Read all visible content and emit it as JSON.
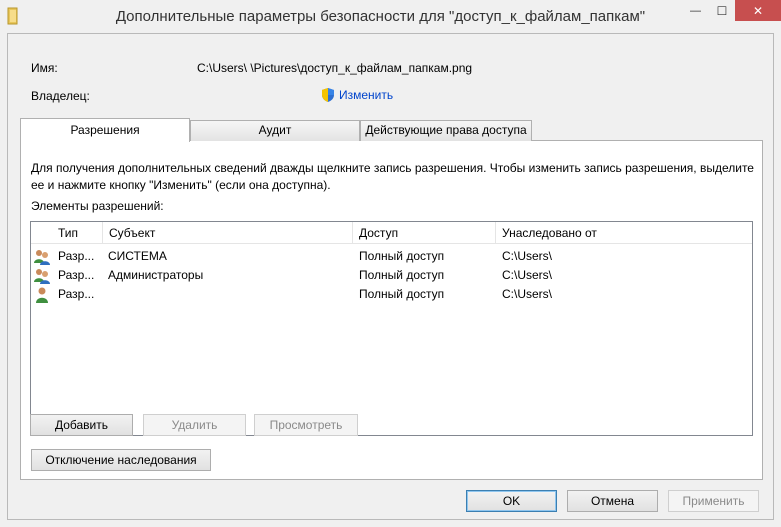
{
  "window": {
    "title": "Дополнительные параметры безопасности  для \"доступ_к_файлам_папкам\"",
    "minimize_glyph": "—",
    "maximize_glyph": "☐",
    "close_glyph": "✕"
  },
  "header": {
    "name_label": "Имя:",
    "name_value": "C:\\Users\\          \\Pictures\\доступ_к_файлам_папкам.png",
    "owner_label": "Владелец:",
    "change_link": "Изменить"
  },
  "tabs": [
    {
      "label": "Разрешения",
      "active": true
    },
    {
      "label": "Аудит",
      "active": false
    },
    {
      "label": "Действующие права доступа",
      "active": false
    }
  ],
  "permissions": {
    "description": "Для получения дополнительных сведений дважды щелкните запись разрешения. Чтобы изменить запись разрешения, выделите ее и нажмите кнопку \"Изменить\" (если она доступна).",
    "list_label": "Элементы разрешений:",
    "columns": [
      "Тип",
      "Субъект",
      "Доступ",
      "Унаследовано от"
    ],
    "rows": [
      {
        "type": "Разр...",
        "subject": "СИСТЕМА",
        "access": "Полный доступ",
        "inherited": "C:\\Users\\",
        "icon": "group-users-icon"
      },
      {
        "type": "Разр...",
        "subject": "Администраторы",
        "access": "Полный доступ",
        "inherited": "C:\\Users\\",
        "icon": "group-users-icon"
      },
      {
        "type": "Разр...",
        "subject": "",
        "access": "Полный доступ",
        "inherited": "C:\\Users\\",
        "icon": "single-user-icon"
      }
    ]
  },
  "buttons": {
    "add": "Добавить",
    "remove": "Удалить",
    "view": "Просмотреть",
    "disable_inheritance": "Отключение наследования",
    "ok": "OK",
    "cancel": "Отмена",
    "apply": "Применить"
  },
  "colors": {
    "close_button": "#c74f4f",
    "link": "#0044cc",
    "default_button_border": "#3c7fb1"
  }
}
